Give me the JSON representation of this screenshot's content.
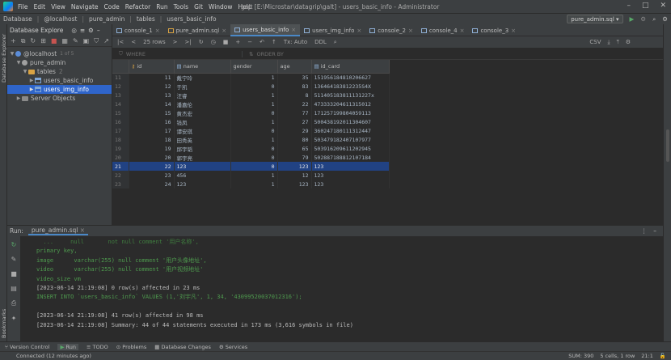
{
  "titlebar": {
    "menu": [
      "File",
      "Edit",
      "View",
      "Navigate",
      "Code",
      "Refactor",
      "Run",
      "Tools",
      "Git",
      "Window",
      "Help"
    ],
    "title": "galt [E:\\Microstar\\datagrip\\galt] - users_basic_info - Administrator"
  },
  "breadcrumb": {
    "items": [
      "Database",
      "@localhost",
      "pure_admin",
      "tables",
      "users_basic_info"
    ],
    "file_select": "pure_admin.sql"
  },
  "explorer": {
    "title": "Database Explore",
    "host": "@localhost",
    "host_count": "1 of 5",
    "schema": "pure_admin",
    "folder": "tables",
    "folder_count": "2",
    "tables": [
      "users_basic_info",
      "users_img_info"
    ],
    "selected_table": "users_img_info",
    "server_objects": "Server Objects"
  },
  "tabs": [
    {
      "label": "console_1",
      "active": false
    },
    {
      "label": "pure_admin.sql",
      "active": false
    },
    {
      "label": "users_basic_info",
      "active": true
    },
    {
      "label": "users_img_info",
      "active": false
    },
    {
      "label": "console_2",
      "active": false
    },
    {
      "label": "console_4",
      "active": false
    },
    {
      "label": "console_3",
      "active": false
    }
  ],
  "gridtools": {
    "rows": "25 rows",
    "tx": "Tx: Auto",
    "ddl": "DDL",
    "csv": "CSV"
  },
  "filter": {
    "where": "WHERE",
    "order_by": "ORDER BY"
  },
  "grid": {
    "columns": [
      "id",
      "name",
      "gender",
      "age",
      "id_card"
    ],
    "rows": [
      {
        "rn": "11",
        "id": "11",
        "name": "戴宁玲",
        "gender": "1",
        "age": "35",
        "id_card": "151956184810206627"
      },
      {
        "rn": "12",
        "id": "12",
        "name": "于凯",
        "gender": "0",
        "age": "83",
        "id_card": "136464183812235S4X"
      },
      {
        "rn": "13",
        "id": "13",
        "name": "汪睿",
        "gender": "1",
        "age": "8",
        "id_card": "511405183811131227x"
      },
      {
        "rn": "14",
        "id": "14",
        "name": "潘嘉伦",
        "gender": "1",
        "age": "22",
        "id_card": "473333204611315012"
      },
      {
        "rn": "15",
        "id": "15",
        "name": "黄杰宏",
        "gender": "0",
        "age": "77",
        "id_card": "171257199804059113"
      },
      {
        "rn": "16",
        "id": "16",
        "name": "钱凤",
        "gender": "1",
        "age": "27",
        "id_card": "500438192011304607"
      },
      {
        "rn": "17",
        "id": "17",
        "name": "谭安琪",
        "gender": "0",
        "age": "29",
        "id_card": "360247180111312447"
      },
      {
        "rn": "18",
        "id": "18",
        "name": "田秀英",
        "gender": "1",
        "age": "80",
        "id_card": "503479182407107977"
      },
      {
        "rn": "19",
        "id": "19",
        "name": "邱宇韬",
        "gender": "0",
        "age": "65",
        "id_card": "503916209611202945"
      },
      {
        "rn": "20",
        "id": "20",
        "name": "郭宇亮",
        "gender": "0",
        "age": "79",
        "id_card": "502887188812107184"
      },
      {
        "rn": "21",
        "id": "22",
        "name": "123",
        "gender": "0",
        "age": "123",
        "id_card": "123"
      },
      {
        "rn": "22",
        "id": "23",
        "name": "456",
        "gender": "1",
        "age": "12",
        "id_card": "123"
      },
      {
        "rn": "23",
        "id": "24",
        "name": "123",
        "gender": "1",
        "age": "123",
        "id_card": "123"
      }
    ],
    "selected_row": 10
  },
  "run": {
    "label": "Run:",
    "tab": "pure_admin.sql",
    "lines": [
      {
        "cls": "c-dim",
        "text": "  ...     null       not null comment '用户名称',"
      },
      {
        "cls": "c-green",
        "text": "primary key,"
      },
      {
        "cls": "c-green",
        "text": "image      varchar(255) null comment '用户头像地址',"
      },
      {
        "cls": "c-green",
        "text": "video      varchar(255) null comment '用户视频地址'"
      },
      {
        "cls": "c-green",
        "text": "video_size vm"
      },
      {
        "cls": "c-log",
        "text": "[2023-06-14 21:19:08] 0 row(s) affected in 23 ms"
      },
      {
        "cls": "c-green",
        "text": "INSERT INTO `users_basic_info` VALUES (1,'刘宇凡', 1, 34, '43099520037012316');"
      },
      {
        "cls": "c-log",
        "text": ""
      },
      {
        "cls": "c-log",
        "text": "[2023-06-14 21:19:08] 41 row(s) affected in 98 ms"
      },
      {
        "cls": "c-log",
        "text": "[2023-06-14 21:19:08] Summary: 44 of 44 statements executed in 173 ms (3,616 symbols in file)"
      }
    ]
  },
  "bottombar": [
    "Version Control",
    "Run",
    "TODO",
    "Problems",
    "Database Changes",
    "Services"
  ],
  "status": {
    "left": "Connected (12 minutes ago)",
    "sum": "SUM: 390",
    "cells": "5 cells, 1 row",
    "pos": "21:1"
  },
  "side": {
    "left": "Database Explorer",
    "bookmarks": "Bookmarks",
    "structure": "Structure"
  }
}
